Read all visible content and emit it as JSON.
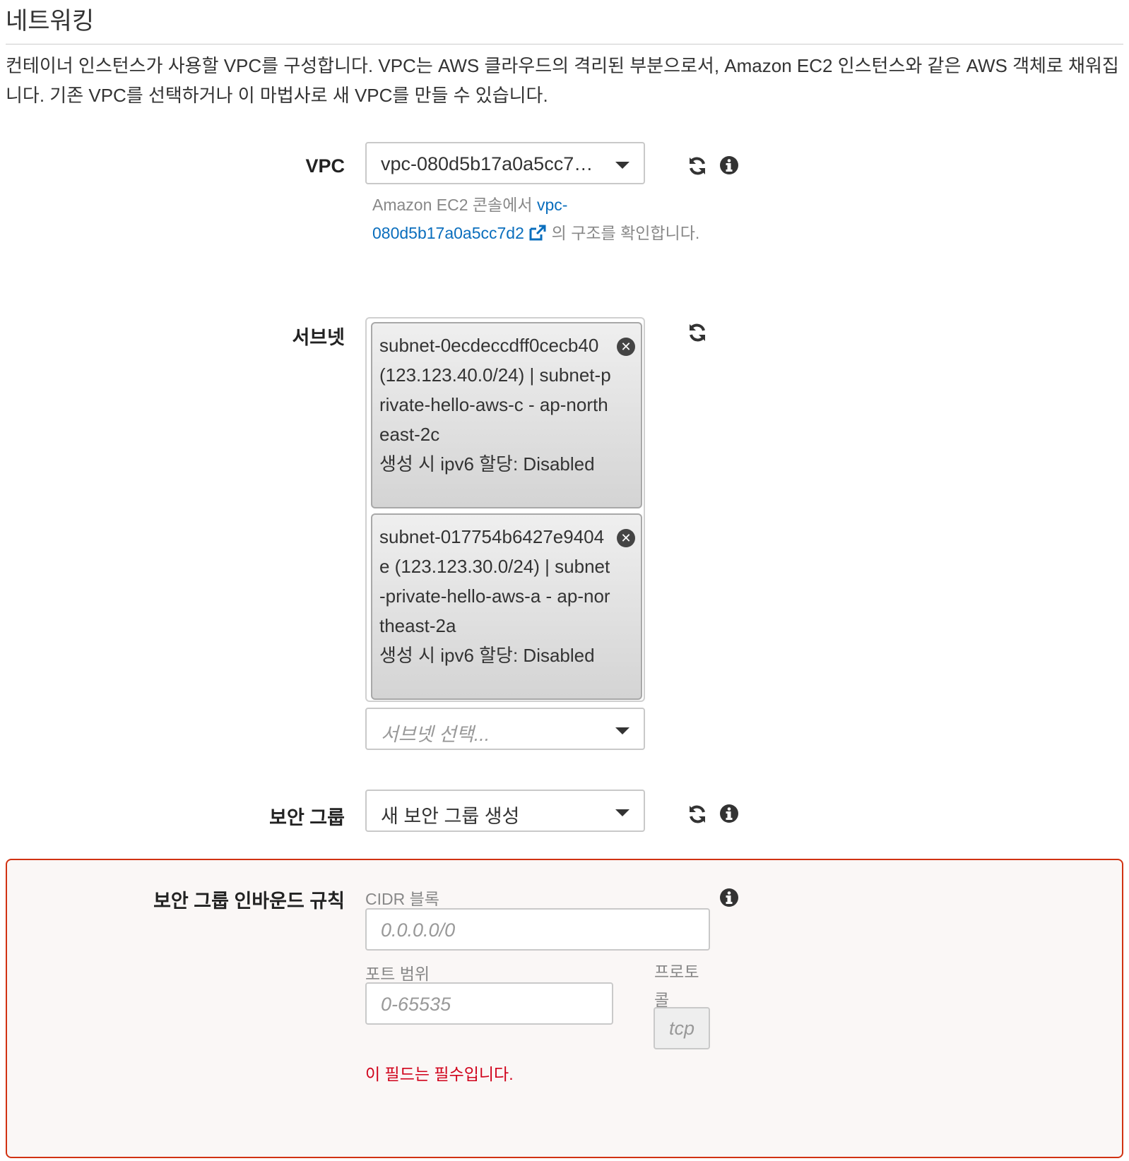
{
  "section": {
    "title": "네트워킹",
    "description": "컨테이너 인스턴스가 사용할 VPC를 구성합니다. VPC는 AWS 클라우드의 격리된 부분으로서, Amazon EC2 인스턴스와 같은 AWS 객체로 채워집니다. 기존 VPC를 선택하거나 이 마법사로 새 VPC를 만들 수 있습니다."
  },
  "vpc": {
    "label": "VPC",
    "selected": "vpc-080d5b17a0a5cc7…",
    "help_prefix": "Amazon EC2 콘솔에서",
    "help_link": "vpc-080d5b17a0a5cc7d2",
    "help_suffix": "의 구조를 확인합니다."
  },
  "subnets": {
    "label": "서브넷",
    "selected": [
      {
        "text": "subnet-0ecdeccdff0cecb40 (123.123.40.0/24) | subnet-private-hello-aws-c - ap-northeast-2c",
        "ipv6": "생성 시 ipv6 할당: Disabled"
      },
      {
        "text": "subnet-017754b6427e9404e (123.123.30.0/24) | subnet-private-hello-aws-a - ap-northeast-2a",
        "ipv6": "생성 시 ipv6 할당: Disabled"
      }
    ],
    "placeholder": "서브넷 선택..."
  },
  "security_group": {
    "label": "보안 그룹",
    "selected": "새 보안 그룹 생성"
  },
  "inbound_rules": {
    "label": "보안 그룹 인바운드 규칙",
    "cidr_label": "CIDR 블록",
    "cidr_placeholder": "0.0.0.0/0",
    "port_label": "포트 범위",
    "port_placeholder": "0-65535",
    "protocol_label": "프로토콜",
    "protocol_value": "tcp",
    "error": "이 필드는 필수입니다."
  },
  "icons": [
    "refresh-icon",
    "info-icon",
    "external-link-icon",
    "remove-icon",
    "caret-down-icon"
  ],
  "colors": {
    "link": "#0a6ebd",
    "error": "#d13212",
    "error_text": "#d0021b"
  }
}
